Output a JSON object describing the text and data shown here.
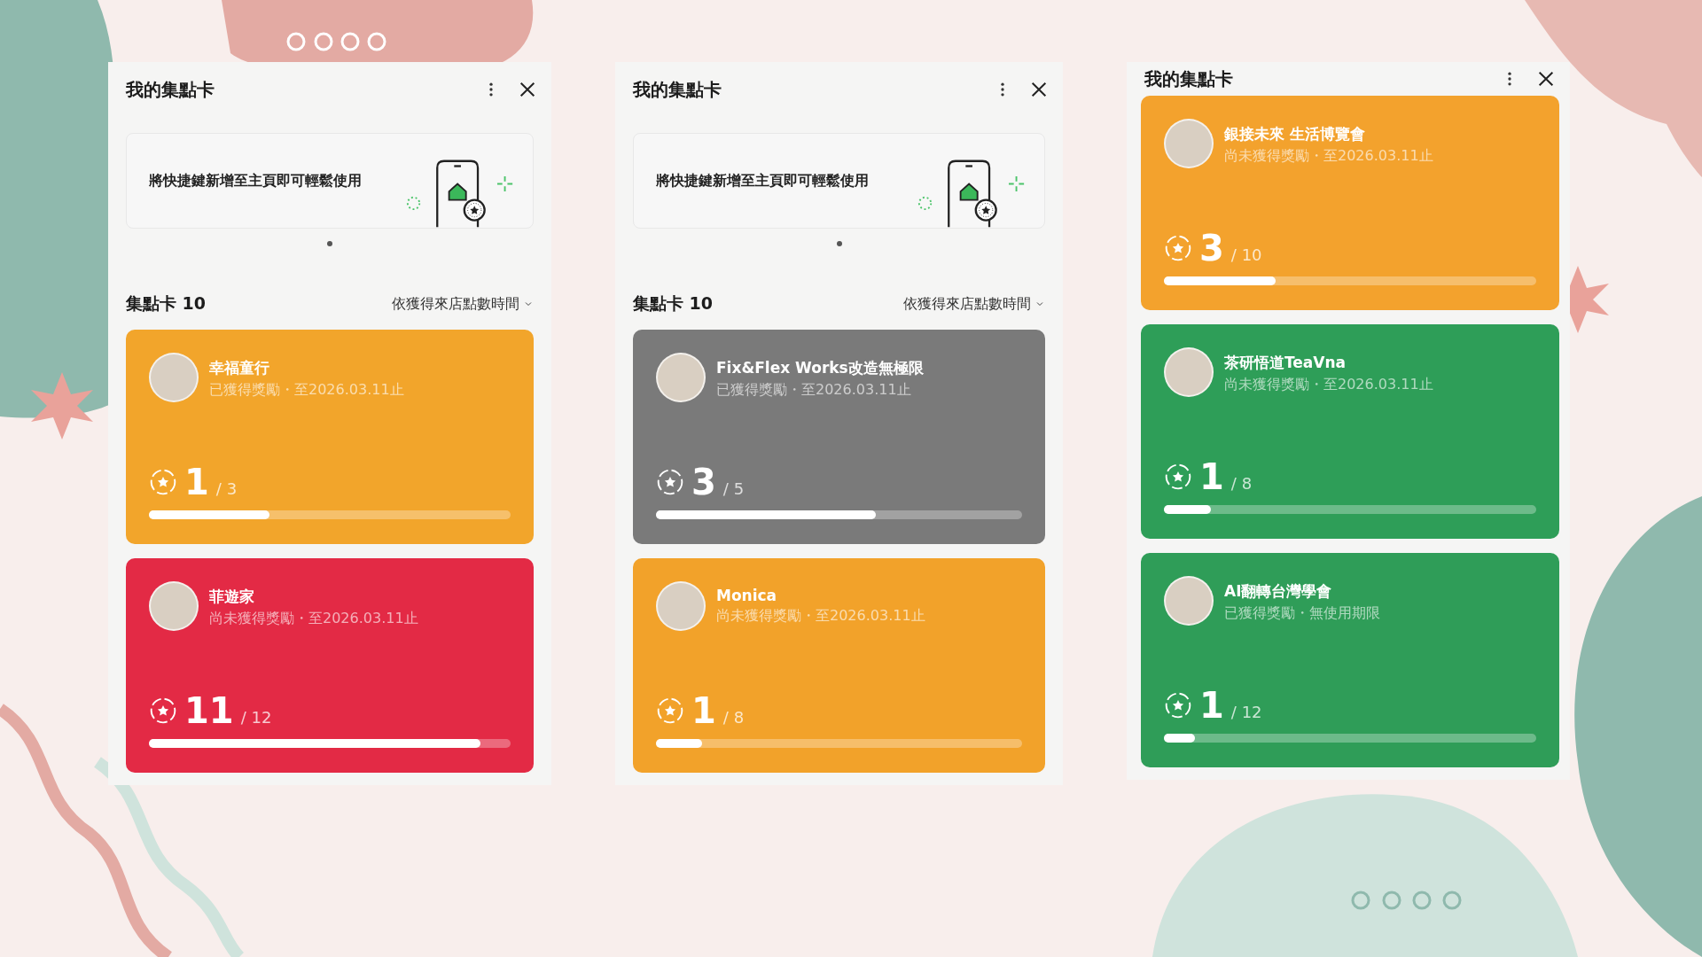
{
  "panels": [
    {
      "title": "我的集點卡",
      "banner": {
        "text": "將快捷鍵新增至主頁即可輕鬆使用"
      },
      "section": {
        "heading": "集點卡 10",
        "sort": "依獲得來店點數時間"
      },
      "cards": [
        {
          "name": "幸福童行",
          "status": "已獲得獎勵・至2026.03.11止",
          "points": "1",
          "total": "/ 3",
          "level": 0.333,
          "color": "#f2a52b"
        },
        {
          "name": "菲遊家",
          "status": "尚未獲得獎勵・至2026.03.11止",
          "points": "11",
          "total": "/ 12",
          "level": 0.917,
          "color": "#e32a45"
        }
      ]
    },
    {
      "title": "我的集點卡",
      "banner": {
        "text": "將快捷鍵新增至主頁即可輕鬆使用"
      },
      "section": {
        "heading": "集點卡 10",
        "sort": "依獲得來店點數時間"
      },
      "cards": [
        {
          "name": "Fix&Flex Works改造無極限",
          "status": "已獲得獎勵・至2026.03.11止",
          "points": "3",
          "total": "/ 5",
          "level": 0.6,
          "color": "#7a7a7a"
        },
        {
          "name": "Monica",
          "status": "尚未獲得獎勵・至2026.03.11止",
          "points": "1",
          "total": "/ 8",
          "level": 0.125,
          "color": "#f2a22a"
        }
      ]
    },
    {
      "title": "我的集點卡",
      "cards": [
        {
          "name": "銀接未來 生活博覽會",
          "status": "尚未獲得獎勵・至2026.03.11止",
          "points": "3",
          "total": "/ 10",
          "level": 0.3,
          "color": "#f3a22d"
        },
        {
          "name": "茶研悟道TeaVna",
          "status": "尚未獲得獎勵・至2026.03.11止",
          "points": "1",
          "total": "/ 8",
          "level": 0.125,
          "color": "#2e9e58"
        },
        {
          "name": "AI翻轉台灣學會",
          "status": "已獲得獎勵・無使用期限",
          "points": "1",
          "total": "/ 12",
          "level": 0.083,
          "color": "#2f9d58"
        }
      ]
    }
  ]
}
